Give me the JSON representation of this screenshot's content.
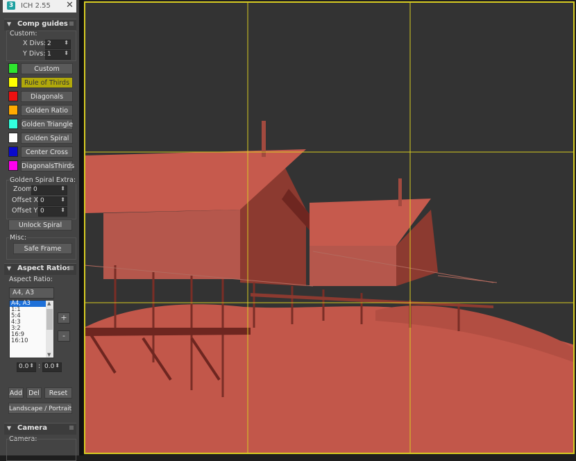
{
  "window": {
    "title": "ICH 2.55",
    "icon": "app-3-icon",
    "close": "✕"
  },
  "comp_guides": {
    "title": "Comp guides",
    "custom_label": "Custom:",
    "x_divs_label": "X Divs:",
    "x_divs_value": "2",
    "y_divs_label": "Y Divs:",
    "y_divs_value": "1",
    "guides": [
      {
        "label": "Custom",
        "color": "#2ee62e",
        "active": false
      },
      {
        "label": "Rule of Thirds",
        "color": "#ffff00",
        "active": true
      },
      {
        "label": "Diagonals",
        "color": "#ee1111",
        "active": false
      },
      {
        "label": "Golden Ratio",
        "color": "#ffaa00",
        "active": false
      },
      {
        "label": "Golden Triangle",
        "color": "#33ffdd",
        "active": false
      },
      {
        "label": "Golden Spiral",
        "color": "#ffffff",
        "active": false
      },
      {
        "label": "Center Cross",
        "color": "#0a0acc",
        "active": false
      },
      {
        "label": "DiagonalsThirds",
        "color": "#ff00ee",
        "active": false
      }
    ],
    "spiral_extra_label": "Golden Spiral Extra:",
    "zoom_label": "Zoom",
    "zoom_value": "0",
    "offset_x_label": "Offset X",
    "offset_x_value": "0",
    "offset_y_label": "Offset Y",
    "offset_y_value": "0",
    "unlock_spiral": "Unlock Spiral",
    "misc_label": "Misc:",
    "safe_frame": "Safe Frame"
  },
  "aspect_ratios": {
    "title": "Aspect Ratios",
    "aspect_label": "Aspect Ratio:",
    "selected": "A4, A3",
    "list": [
      "A4, A3",
      "1:1",
      "5:4",
      "4:3",
      "3:2",
      "16:9",
      "16:10"
    ],
    "plus": "+",
    "minus": "-",
    "ratio_a": "0.0",
    "ratio_sep": ":",
    "ratio_b": "0.0",
    "add": "Add",
    "del": "Del",
    "reset": "Reset",
    "landscape_portrait": "Landscape / Portrait"
  },
  "camera": {
    "title": "Camera",
    "camera_label": "Camera:"
  },
  "viewport": {
    "guide_color": "#d8cc22",
    "bg": "#333333",
    "model_color": "#c2574a"
  }
}
